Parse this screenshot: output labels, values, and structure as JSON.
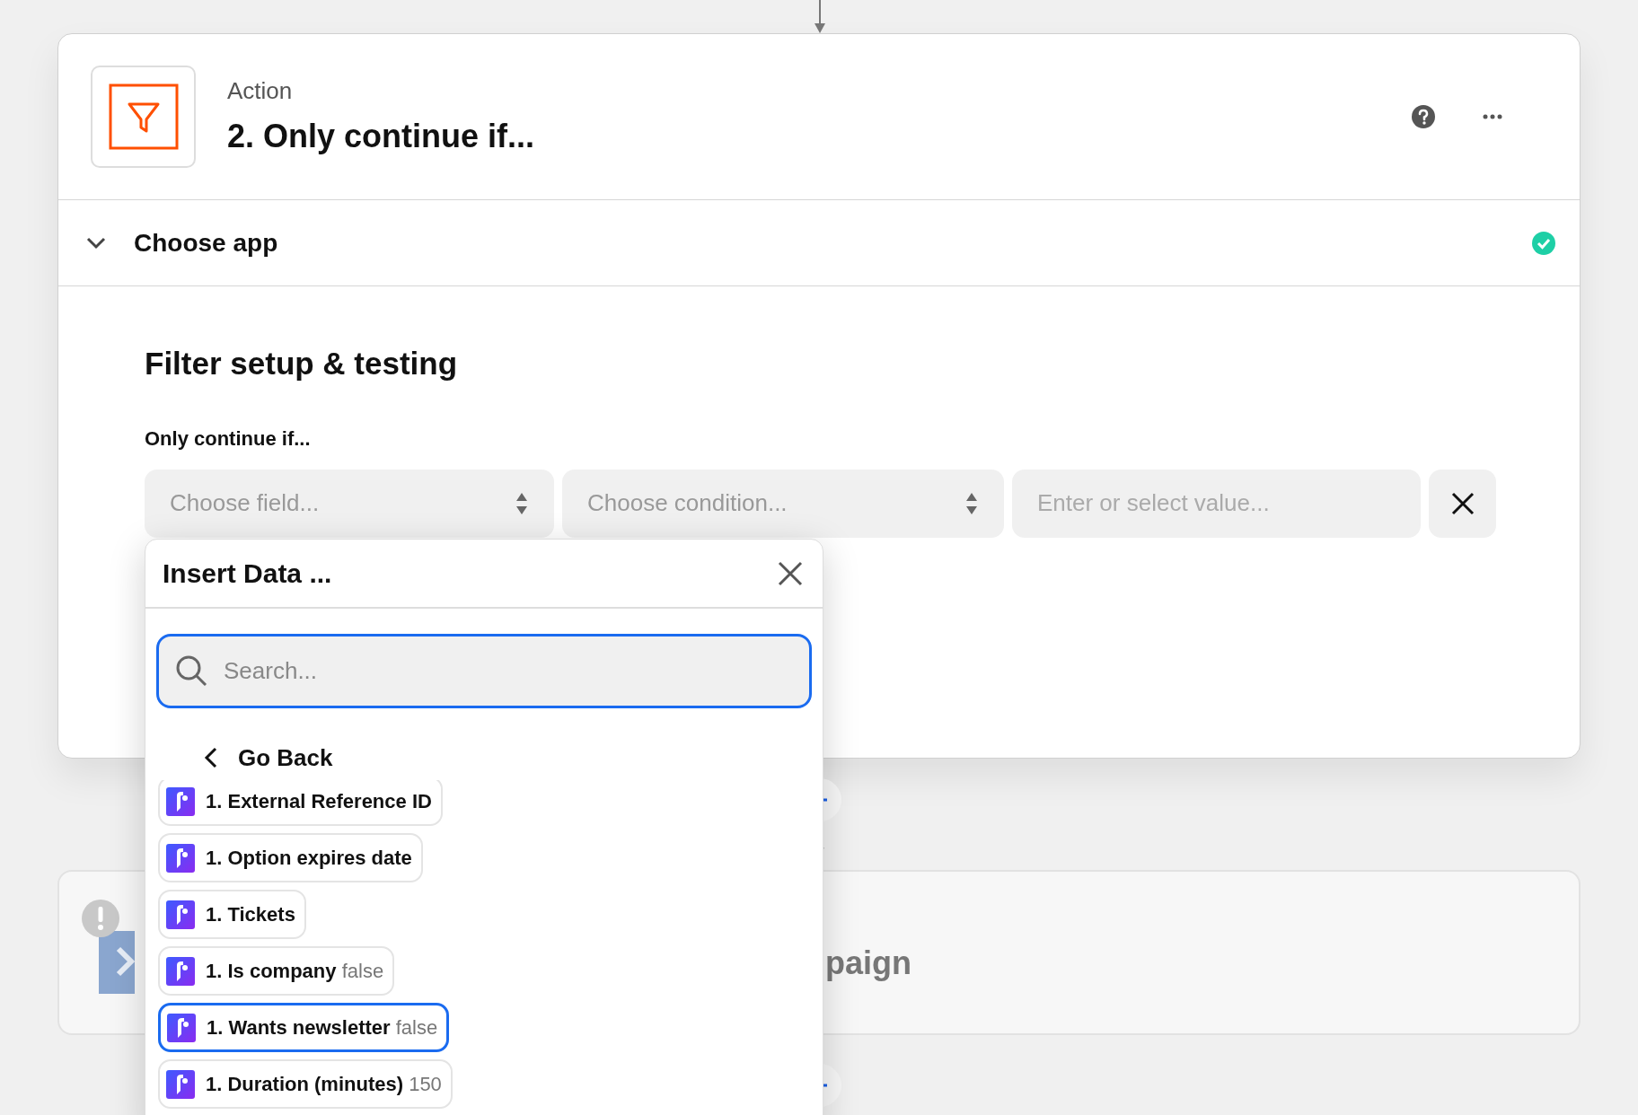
{
  "step": {
    "label": "Action",
    "title": "2. Only continue if...",
    "sections": [
      {
        "title": "Choose app",
        "expanded": true,
        "done": true
      }
    ]
  },
  "filter": {
    "heading": "Filter setup & testing",
    "label": "Only continue if...",
    "field": {
      "placeholder": "Choose field..."
    },
    "condition": {
      "placeholder": "Choose condition..."
    },
    "value": {
      "placeholder": "Enter or select value..."
    }
  },
  "insert_data": {
    "title": "Insert Data ...",
    "search": {
      "placeholder": "Search..."
    },
    "back": "Go Back",
    "items": [
      {
        "label": "1. External Reference ID",
        "selected": false
      },
      {
        "label": "1. Option expires date",
        "selected": false
      },
      {
        "label": "1. Tickets",
        "selected": false
      },
      {
        "label": "1. Is company",
        "value": "false",
        "selected": false
      },
      {
        "label": "1. Wants newsletter",
        "value": "false",
        "selected": true
      },
      {
        "label": "1. Duration (minutes)",
        "value": "150",
        "selected": false
      }
    ]
  },
  "next_step": {
    "title": "paign",
    "warning": true
  }
}
